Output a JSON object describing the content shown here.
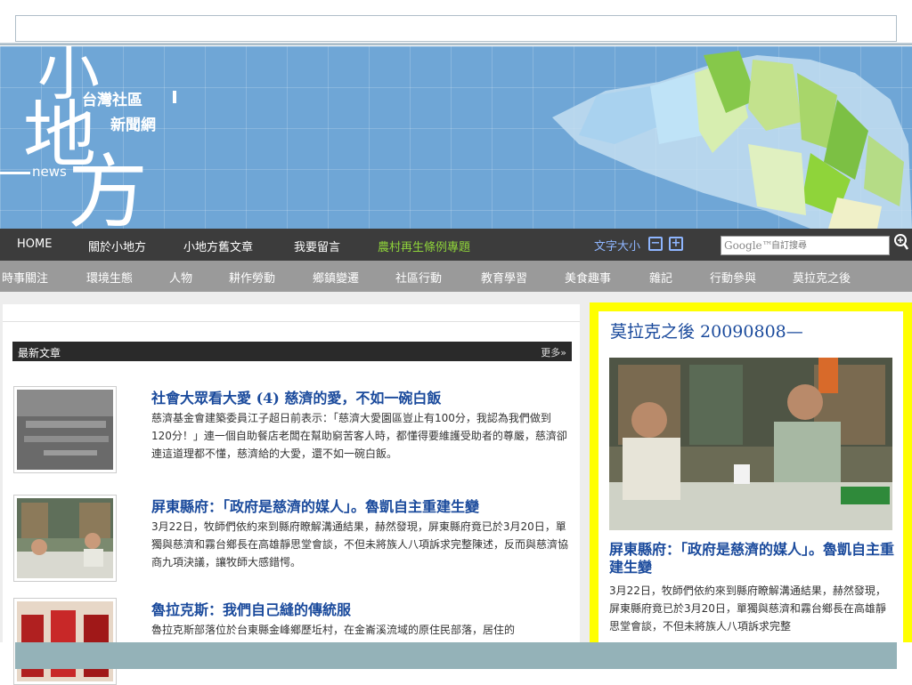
{
  "site": {
    "logo_big1": "小",
    "logo_big2": "地",
    "logo_big3": "方",
    "logo_sub1": "台灣社區",
    "logo_sub2": "新聞網",
    "logo_news": "news"
  },
  "nav_primary": [
    {
      "label": "HOME"
    },
    {
      "label": "關於小地方"
    },
    {
      "label": "小地方舊文章"
    },
    {
      "label": "我要留言"
    },
    {
      "label": "農村再生條例專題",
      "highlight": true
    }
  ],
  "font_size": {
    "label": "文字大小",
    "decrease": "−",
    "increase": "+"
  },
  "search": {
    "brand": "Google™",
    "placeholder": "自訂搜尋"
  },
  "nav_secondary": [
    {
      "label": "時事關注"
    },
    {
      "label": "環境生態"
    },
    {
      "label": "人物"
    },
    {
      "label": "耕作勞動"
    },
    {
      "label": "鄉鎮變遷"
    },
    {
      "label": "社區行動"
    },
    {
      "label": "教育學習"
    },
    {
      "label": "美食趣事"
    },
    {
      "label": "雜記"
    },
    {
      "label": "行動參與"
    },
    {
      "label": "莫拉克之後"
    }
  ],
  "latest": {
    "heading": "最新文章",
    "more": "更多»",
    "articles": [
      {
        "title": "社會大眾看大愛 (4) 慈濟的愛，不如一碗白飯",
        "desc": "慈濟基金會建築委員江子超日前表示：「慈濟大愛園區豈止有100分，我認為我們做到120分！」連一個自助餐店老闆在幫助窮苦客人時，都懂得要維護受助者的尊嚴，慈濟卻連這道理都不懂，慈濟給的大愛，還不如一碗白飯。"
      },
      {
        "title": "屏東縣府：「政府是慈濟的媒人」。魯凱自主重建生變",
        "desc": "3月22日，牧師們依約來到縣府瞭解溝通結果，赫然發現，屏東縣府竟已於3月20日，單獨與慈濟和霧台鄉長在高雄靜思堂會談，不但未將族人八項訴求完整陳述，反而與慈濟協商九項決議，讓牧師大感錯愕。"
      },
      {
        "title": "魯拉克斯：我們自己縫的傳統服",
        "desc": "魯拉克斯部落位於台東縣金峰鄉歷坵村，在金崙溪流域的原住民部落，居住的"
      }
    ]
  },
  "featured": {
    "title": "莫拉克之後 20090808—",
    "subtitle": "屏東縣府：「政府是慈濟的媒人」。魯凱自主重建生變",
    "desc": "3月22日，牧師們依約來到縣府瞭解溝通結果，赫然發現，屏東縣府竟已於3月20日，單獨與慈濟和霧台鄉長在高雄靜思堂會談，不但未將族人八項訴求完整"
  },
  "colors": {
    "banner_bg": "#6fa6d6",
    "nav_primary_bg": "#3c3c3c",
    "nav_secondary_bg": "#9a9a9a",
    "highlight_green": "#8fd43a",
    "featured_border": "#ffff00",
    "link_blue": "#1a4a9c"
  }
}
